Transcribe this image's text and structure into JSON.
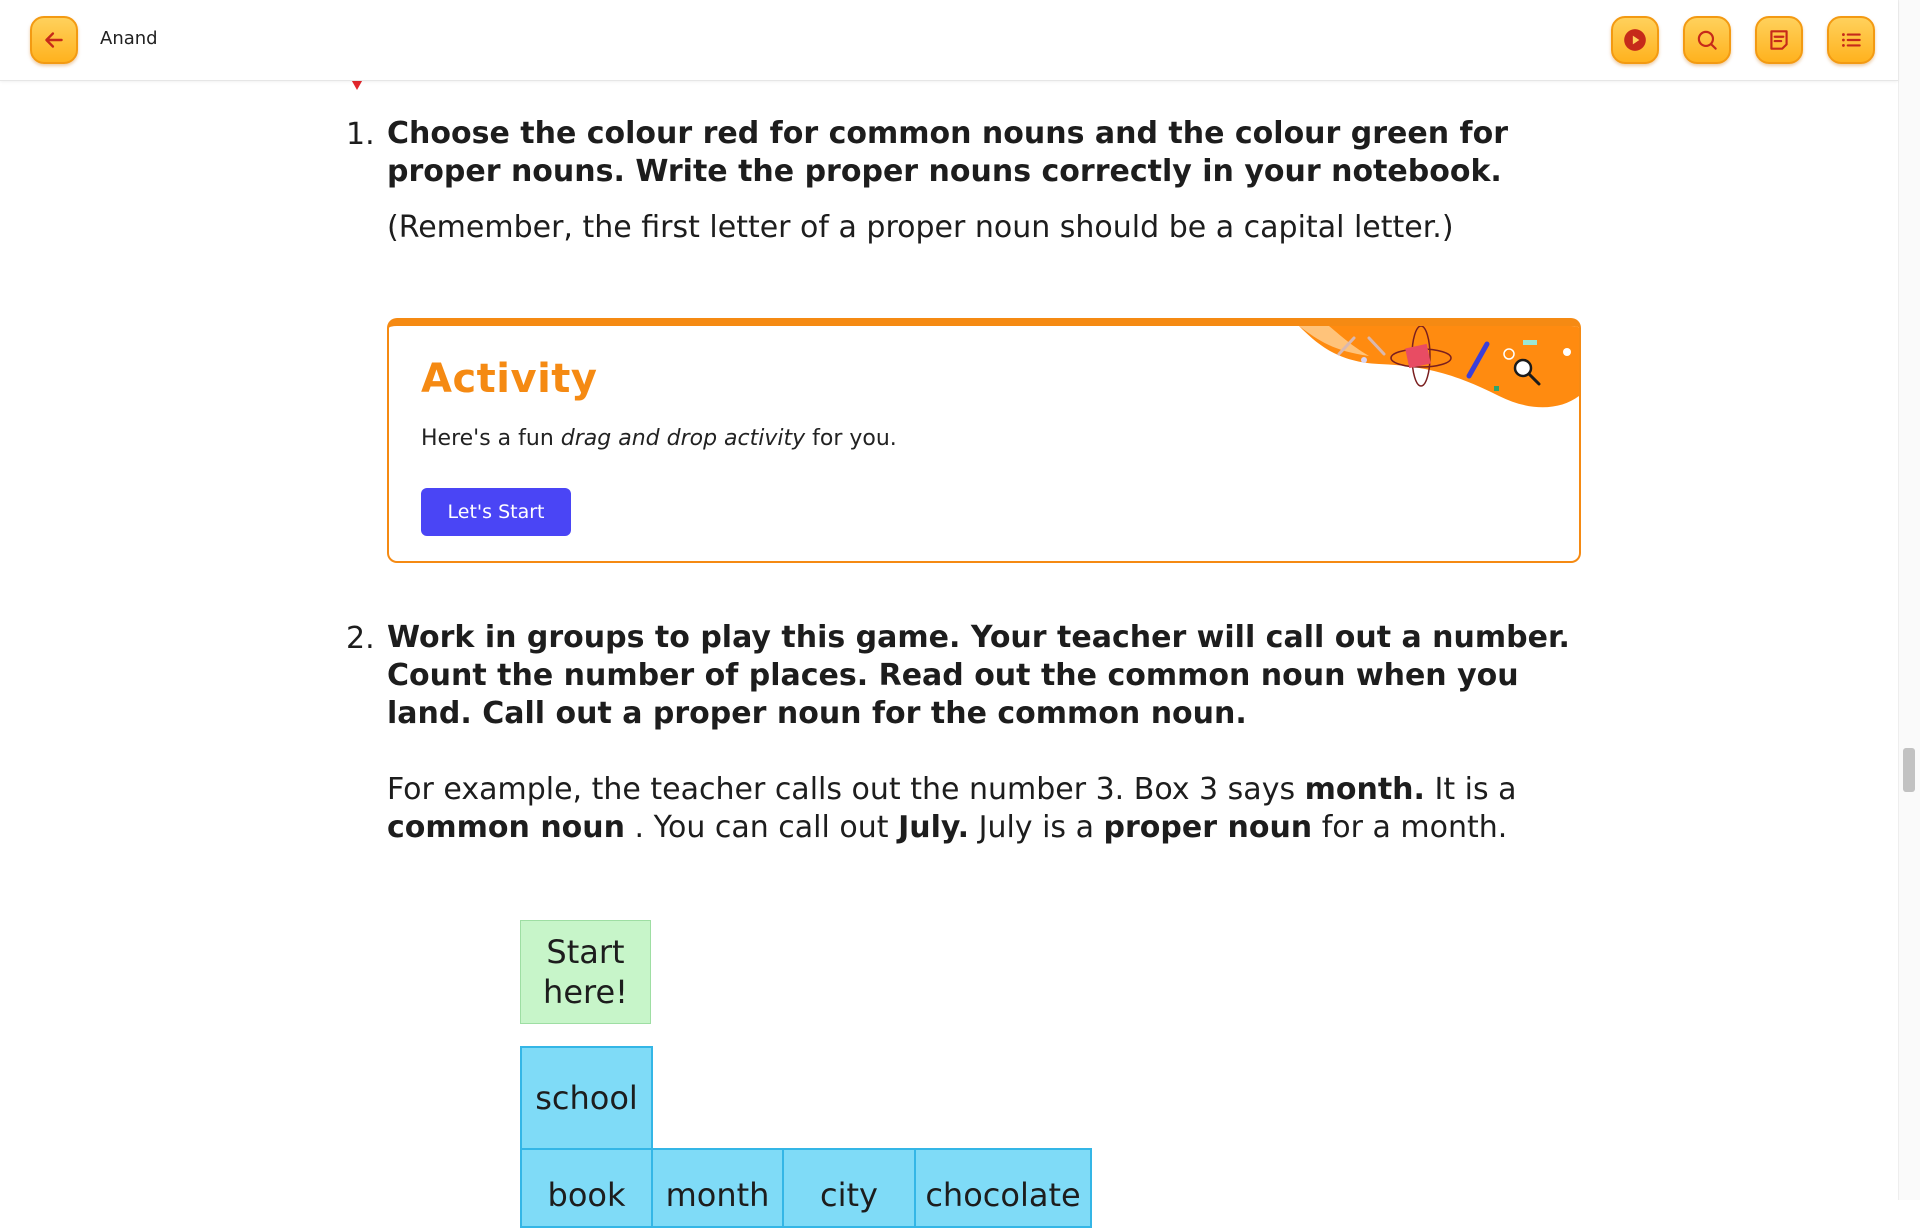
{
  "header": {
    "title": "Anand",
    "buttons": [
      "back",
      "play",
      "search",
      "notes",
      "table-of-contents"
    ]
  },
  "question1": {
    "number": "1.",
    "text": "Choose the colour red for common nouns and the colour green for proper nouns. Write the proper nouns correctly in your notebook.",
    "note": "(Remember, the first letter of a proper noun should be a capital letter.)"
  },
  "activity": {
    "title": "Activity",
    "desc_before": "Here's a fun ",
    "desc_italic": "drag and drop activity",
    "desc_after": " for you.",
    "button_label": "Let's Start"
  },
  "question2": {
    "number": "2.",
    "text": "Work in groups to play this game. Your teacher will call out a number. Count the number of places. Read out the common noun when you land. Call out a proper noun for the common noun.",
    "example": {
      "p1": "For example, the teacher calls out the number 3. Box 3 says ",
      "b1": "month.",
      "p2": " It is a ",
      "b2": "common noun",
      "p3": " . You can call out ",
      "b3": "July.",
      "p4": " July is a ",
      "b4": "proper noun",
      "p5": " for a month."
    }
  },
  "board": {
    "start": "Start here!",
    "cells": [
      "school",
      "book",
      "month",
      "city",
      "chocolate"
    ]
  },
  "colors": {
    "accent": "#f58a13",
    "button": "#4a45f5",
    "start_cell": "#c7f5c9",
    "board_cell": "#7fdbf7"
  }
}
